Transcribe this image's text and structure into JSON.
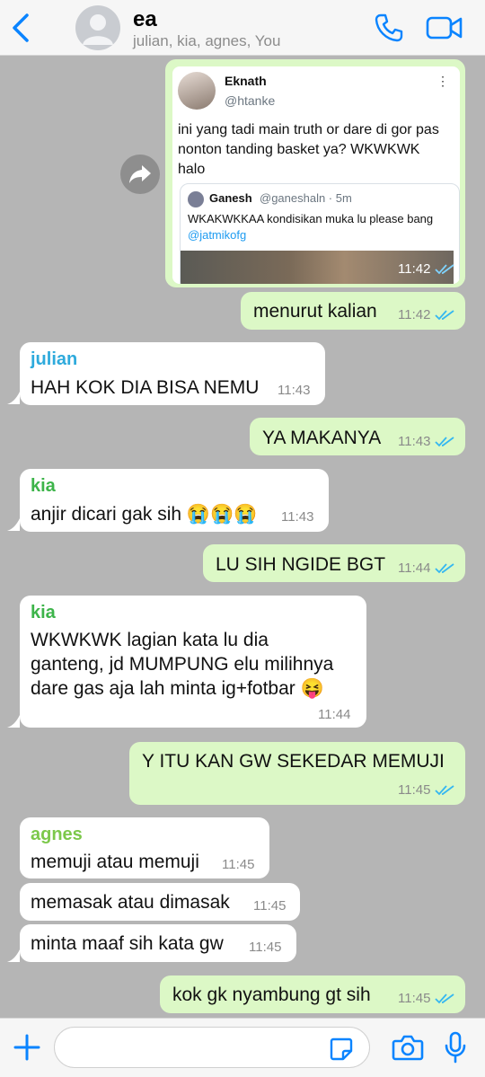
{
  "header": {
    "title": "ea",
    "subtitle": "julian, kia, agnes, You"
  },
  "colors": {
    "accent": "#0a84ff",
    "outgoing_bubble": "#dcf8c6",
    "incoming_bubble": "#ffffff",
    "sender_julian": "#2eaadc",
    "sender_kia": "#3db44a",
    "sender_agnes": "#7cc84a",
    "read_ticks": "#34b7f1"
  },
  "tweet": {
    "name": "Eknath",
    "handle": "@htanke",
    "more": "⋮",
    "text": "ini yang tadi main truth or dare di gor pas nonton tanding basket ya? WKWKWK halo",
    "quote": {
      "name": "Ganesh",
      "handle": "@ganeshaln · 5m",
      "text": "WKAKWKKAA kondisikan muka lu please bang ",
      "mention": "@jatmikofg"
    },
    "time": "11:42"
  },
  "messages": [
    {
      "text": "menurut kalian",
      "time": "11:42"
    },
    {
      "sender": "julian",
      "text": "HAH KOK DIA BISA NEMU",
      "time": "11:43"
    },
    {
      "text": "YA MAKANYA",
      "time": "11:43"
    },
    {
      "sender": "kia",
      "text": "anjir dicari gak sih 😭😭😭",
      "time": "11:43"
    },
    {
      "text": "LU SIH NGIDE BGT",
      "time": "11:44"
    },
    {
      "sender": "kia",
      "line1": "WKWKWK lagian kata lu dia",
      "line2": "ganteng, jd MUMPUNG elu milihnya",
      "line3": "dare gas aja lah minta ig+fotbar 😝",
      "time": "11:44"
    },
    {
      "text": "Y ITU KAN GW SEKEDAR MEMUJI",
      "time": "11:45"
    },
    {
      "sender": "agnes",
      "text": "memuji atau memuji",
      "time": "11:45"
    },
    {
      "text": "memasak atau dimasak",
      "time": "11:45"
    },
    {
      "text": "minta maaf sih kata gw",
      "time": "11:45"
    },
    {
      "text": "kok gk nyambung gt sih",
      "time": "11:45"
    }
  ],
  "input": {
    "placeholder": ""
  },
  "icons": {
    "back": "chevron-left-icon",
    "phone": "phone-icon",
    "video": "video-camera-icon",
    "forward": "forward-arrow-icon",
    "plus": "plus-icon",
    "sticker": "sticker-icon",
    "camera": "camera-icon",
    "mic": "microphone-icon"
  }
}
